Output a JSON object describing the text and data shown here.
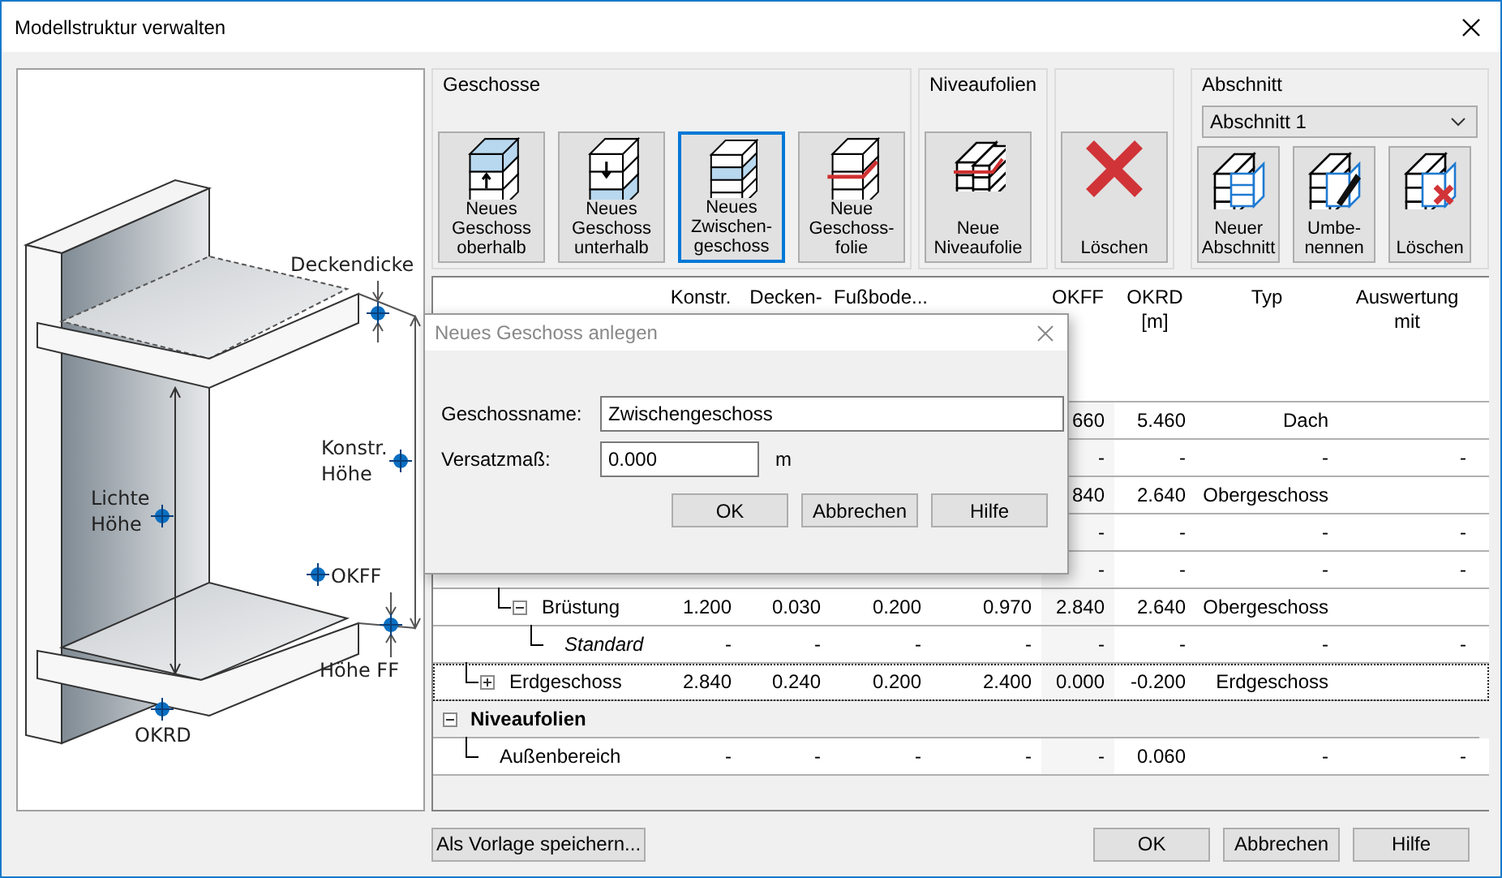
{
  "window": {
    "title": "Modellstruktur verwalten"
  },
  "diagram": {
    "labels": [
      "Deckendicke",
      "Konstr.\nHöhe",
      "Lichte\nHöhe",
      "OKFF",
      "Höhe FF",
      "OKRD"
    ]
  },
  "toolbar": {
    "groups": [
      {
        "title": "Geschosse",
        "buttons": [
          {
            "label": "Neues\nGeschoss\noberhalb",
            "selected": false
          },
          {
            "label": "Neues\nGeschoss\nunterhalb",
            "selected": false
          },
          {
            "label": "Neues\nZwischen-\ngeschoss",
            "selected": true
          },
          {
            "label": "Neue\nGeschoss-\nfolie",
            "selected": false
          }
        ]
      },
      {
        "title": "Niveaufolien",
        "buttons": [
          {
            "label": "Neue\nNiveaufolie",
            "selected": false
          }
        ]
      },
      {
        "buttons": [
          {
            "label": "Löschen",
            "selected": false
          }
        ]
      }
    ],
    "section": {
      "title": "Abschnitt",
      "dropdown": "Abschnitt 1",
      "buttons": [
        {
          "label": "Neuer\nAbschnitt"
        },
        {
          "label": "Umbe-\nnennen"
        },
        {
          "label": "Löschen"
        }
      ]
    }
  },
  "table": {
    "columns": {
      "konstr": [
        "Konstr."
      ],
      "decken": [
        "Decken-"
      ],
      "fussboden": [
        "Fußbode..."
      ],
      "okff": [
        "OKFF"
      ],
      "okrd": [
        "OKRD",
        "[m]"
      ],
      "typ": [
        "Typ"
      ],
      "auswertung": [
        "Auswertung",
        "mit"
      ]
    },
    "rows": [
      {
        "kind": "item",
        "selected": false,
        "values": {
          "okff": "660",
          "okrd": "5.460",
          "typ": "Dach"
        },
        "children": [
          {
            "kind": "item",
            "selected": false,
            "values": {
              "okff": "-",
              "okrd": "-",
              "typ": "-",
              "auswertung": "-"
            }
          }
        ]
      },
      {
        "kind": "item",
        "selected": false,
        "values": {
          "okff": "840",
          "okrd": "2.640",
          "typ": "Obergeschoss"
        },
        "children": [
          {
            "kind": "item",
            "selected": false,
            "values": {
              "okff": "-",
              "okrd": "-",
              "typ": "-",
              "auswertung": "-"
            }
          },
          {
            "kind": "item",
            "selected": false,
            "values": {
              "okff": "-",
              "okrd": "-",
              "typ": "-",
              "auswertung": "-"
            }
          },
          {
            "kind": "item",
            "label": "Brüstung",
            "expanded": true,
            "selected": false,
            "values": {
              "konstr": "1.200",
              "decken": "0.030",
              "fussboden": "0.200",
              "lichte": "0.970",
              "okff": "2.840",
              "okrd": "2.640",
              "typ": "Obergeschoss"
            },
            "children": [
              {
                "kind": "item",
                "label": "Standard",
                "italic": true,
                "selected": false,
                "values": {
                  "konstr": "-",
                  "decken": "-",
                  "fussboden": "-",
                  "lichte": "-",
                  "okff": "-",
                  "okrd": "-",
                  "typ": "-",
                  "auswertung": "-"
                }
              }
            ]
          }
        ]
      },
      {
        "kind": "item",
        "label": "Erdgeschoss",
        "expanded": false,
        "selected": true,
        "values": {
          "konstr": "2.840",
          "decken": "0.240",
          "fussboden": "0.200",
          "lichte": "2.400",
          "okff": "0.000",
          "okrd": "-0.200",
          "typ": "Erdgeschoss"
        }
      },
      {
        "kind": "group",
        "label": "Niveaufolien",
        "expanded": true,
        "children": [
          {
            "kind": "item",
            "label": "Außenbereich",
            "selected": false,
            "values": {
              "konstr": "-",
              "decken": "-",
              "fussboden": "-",
              "lichte": "-",
              "okff": "-",
              "okrd": "0.060",
              "typ": "-",
              "auswertung": "-"
            }
          }
        ]
      }
    ]
  },
  "footer": {
    "left": "Als Vorlage speichern...",
    "buttons": [
      "OK",
      "Abbrechen",
      "Hilfe"
    ]
  },
  "dialog": {
    "title": "Neues Geschoss anlegen",
    "fields": [
      {
        "label": "Geschossname:",
        "value": "Zwischengeschoss"
      },
      {
        "label": "Versatzmaß:",
        "value": "0.000",
        "unit": "m"
      }
    ],
    "buttons": [
      "OK",
      "Abbrechen",
      "Hilfe"
    ]
  }
}
